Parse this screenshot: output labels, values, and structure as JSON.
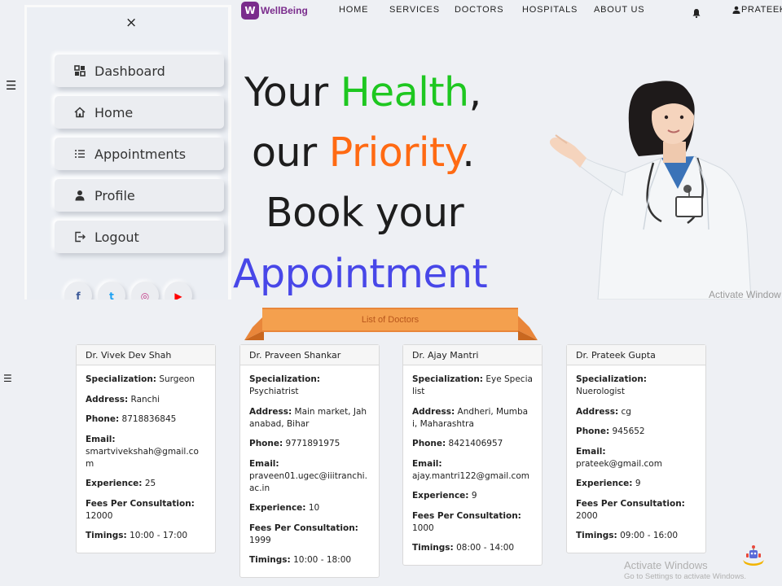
{
  "sidebar": {
    "close_label": "×",
    "items": [
      {
        "label": "Dashboard",
        "icon": "dashboard-icon"
      },
      {
        "label": "Home",
        "icon": "home-icon"
      },
      {
        "label": "Appointments",
        "icon": "list-icon"
      },
      {
        "label": "Profile",
        "icon": "user-doctor-icon"
      },
      {
        "label": "Logout",
        "icon": "logout-icon"
      }
    ],
    "social": [
      {
        "icon": "facebook-icon",
        "glyph": "f",
        "color": "#3b5998"
      },
      {
        "icon": "twitter-icon",
        "glyph": "t",
        "color": "#1da1f2"
      },
      {
        "icon": "instagram-icon",
        "glyph": "◎",
        "color": "#c13584"
      },
      {
        "icon": "youtube-icon",
        "glyph": "▶",
        "color": "#ff0000"
      }
    ]
  },
  "brand": {
    "name": "WellBeing",
    "logo_glyph": "W",
    "color": "#7a2b8c"
  },
  "nav": [
    "HOME",
    "SERVICES",
    "DOCTORS",
    "HOSPITALS",
    "ABOUT US"
  ],
  "user": {
    "name": "PRATEEK"
  },
  "hero": {
    "line1_a": "Your ",
    "line1_b": "Health",
    "line1_c": ",",
    "line2_a": "our ",
    "line2_b": "Priority",
    "line2_c": ".",
    "line3": "Book your",
    "line4": "Appointment"
  },
  "ribbon": {
    "label": "List of Doctors"
  },
  "labels": {
    "specialization": "Specialization:",
    "address": "Address:",
    "phone": "Phone:",
    "email": "Email:",
    "experience": "Experience:",
    "fees": "Fees Per Consultation:",
    "timings": "Timings:"
  },
  "doctors": [
    {
      "name": "Dr. Vivek Dev Shah",
      "specialization": "Surgeon",
      "address": "Ranchi",
      "phone": "8718836845",
      "email": "smartvivekshah@gmail.com",
      "experience": "25",
      "fees": "12000",
      "timings": "10:00 - 17:00"
    },
    {
      "name": "Dr. Praveen Shankar",
      "specialization": "Psychiatrist",
      "address": "Main market, Jahanabad, Bihar",
      "phone": "9771891975",
      "email": "praveen01.ugec@iiitranchi.ac.in",
      "experience": "10",
      "fees": "1999",
      "timings": "10:00 - 18:00"
    },
    {
      "name": "Dr. Ajay Mantri",
      "specialization": "Eye Specialist",
      "address": "Andheri, Mumbai, Maharashtra",
      "phone": "8421406957",
      "email": "ajay.mantri122@gmail.com",
      "experience": "9",
      "fees": "1000",
      "timings": "08:00 - 14:00"
    },
    {
      "name": "Dr. Prateek Gupta",
      "specialization": "Nuerologist",
      "address": "cg",
      "phone": "945652",
      "email": "prateek@gmail.com",
      "experience": "9",
      "fees": "2000",
      "timings": "09:00 - 16:00"
    }
  ],
  "watermark": {
    "title": "Activate Windows",
    "title_top": "Activate Window",
    "subtitle": "Go to Settings to activate Windows."
  },
  "colors": {
    "accent_green": "#1ec720",
    "accent_orange": "#ff6a13",
    "accent_blue": "#4847e8",
    "ribbon": "#f4a04e"
  }
}
